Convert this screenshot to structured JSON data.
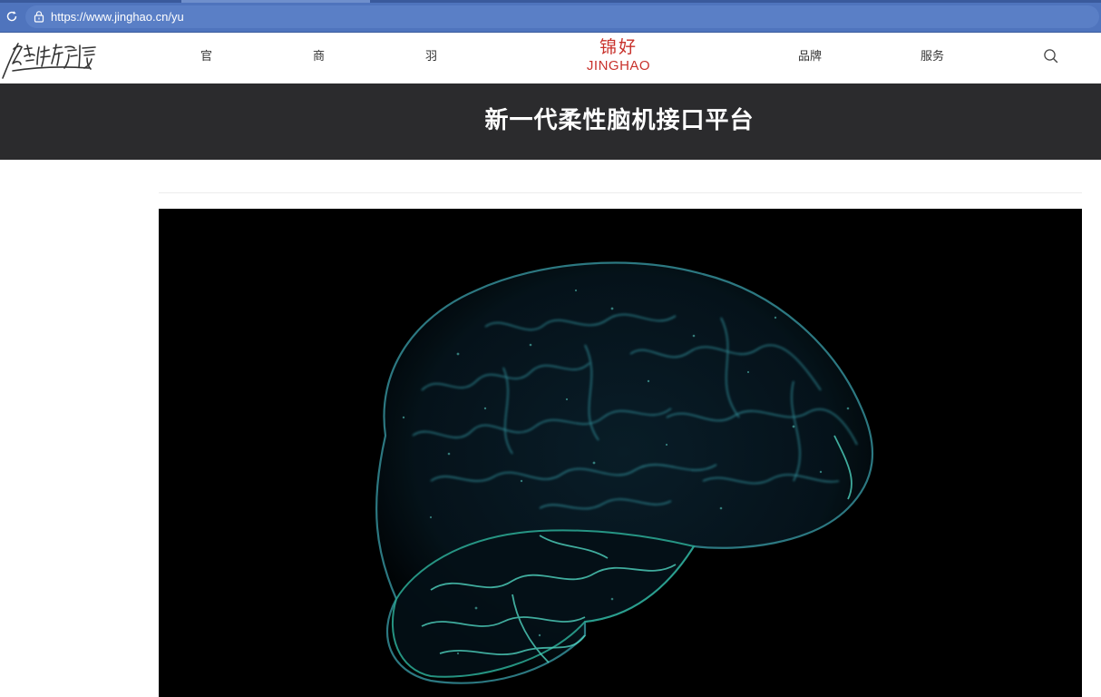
{
  "browser": {
    "url": "https://www.jinghao.cn/yu"
  },
  "header": {
    "signature_logo_text": "陪伴有声情",
    "nav": [
      {
        "label": "官"
      },
      {
        "label": "商"
      },
      {
        "label": "羽"
      },
      {
        "label": "品牌"
      },
      {
        "label": "服务"
      }
    ],
    "brand": {
      "cn": "锦好",
      "en": "JINGHAO",
      "color": "#c8312b"
    }
  },
  "banner": {
    "title": "新一代柔性脑机接口平台",
    "background": "#2b2b2d"
  },
  "hero": {
    "image_subject": "brain-visualization",
    "accent_color": "#3fbfae"
  },
  "icons": {
    "reload": "reload-icon",
    "lock": "lock-icon",
    "search": "search-icon"
  }
}
